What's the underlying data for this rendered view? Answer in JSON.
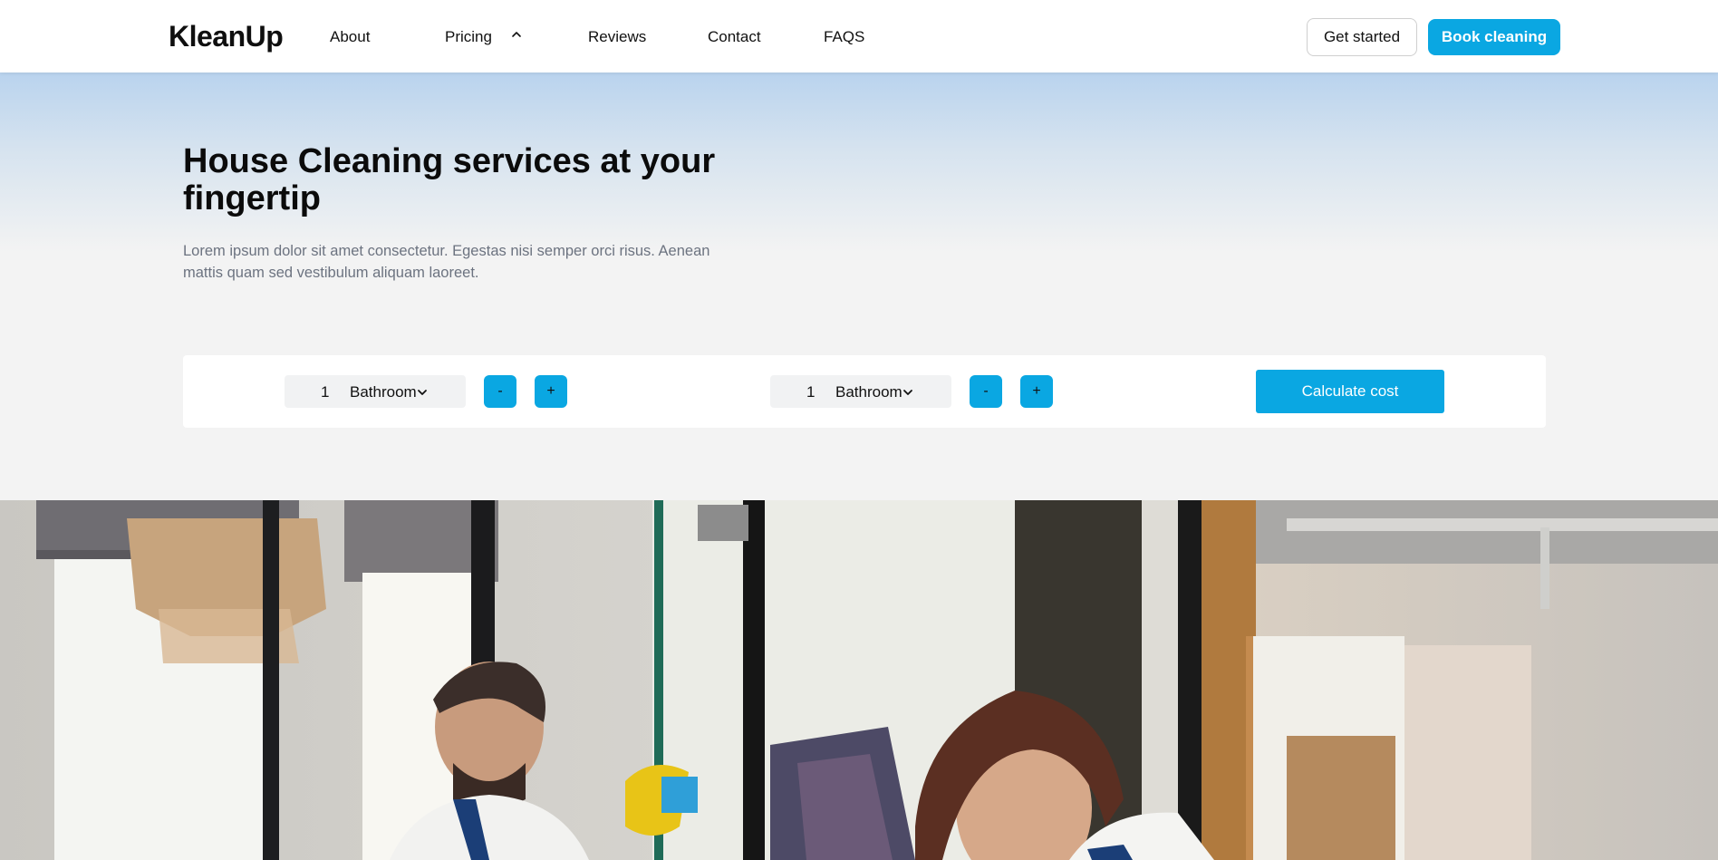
{
  "brand": {
    "name": "KleanUp"
  },
  "nav": {
    "links": [
      "About",
      "Pricing",
      "Reviews",
      "Contact",
      "FAQS"
    ],
    "pricing_caret_icon": "chevron-up-icon",
    "get_started_label": "Get started",
    "book_cleaning_label": "Book cleaning"
  },
  "hero": {
    "title": "House Cleaning services at your fingertip",
    "description": "Lorem ipsum dolor sit amet consectetur. Egestas nisi semper orci risus. Aenean mattis quam sed vestibulum aliquam laoreet."
  },
  "calculator": {
    "rooms": [
      {
        "count": "1",
        "room_type": "Bathroom",
        "minus_label": "-",
        "plus_label": "+"
      },
      {
        "count": "1",
        "room_type": "Bathroom",
        "minus_label": "-",
        "plus_label": "+"
      }
    ],
    "calculate_label": "Calculate cost"
  },
  "photo": {
    "icon": "cleaning-staff-photo"
  },
  "colors": {
    "accent": "#0aa7e2",
    "hero_top": "#b9d3ee",
    "background": "#f3f3f3"
  }
}
